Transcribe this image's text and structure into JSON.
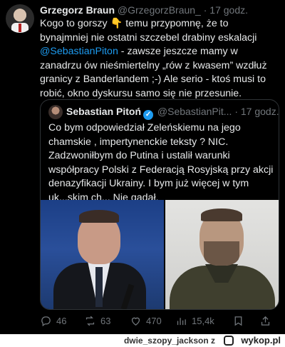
{
  "tweet": {
    "author_name": "Grzegorz Braun",
    "author_handle": "@GrzegorzBraun_",
    "time_sep": "·",
    "time": "17 godz.",
    "text_a": "Kogo to gorszy ",
    "emoji": "👇",
    "text_b": " temu przypomnę, że to bynajmniej nie ostatni szczebel drabiny eskalacji ",
    "mention": "@SebastianPiton",
    "text_c": " - zawsze jeszcze mamy w zanadrzu ów nieśmiertelny „rów z kwasem” wzdłuż granicy z Banderlandem ;-) Ale serio - ktoś musi to robić, okno dyskursu samo się nie przesunie."
  },
  "quote": {
    "author_name": "Sebastian Pitoń",
    "verified": "✓",
    "author_handle": "@SebastianPit...",
    "time_sep": "·",
    "time": "17 godz.",
    "text": "Co bym odpowiedział Zeleńskiemu na jego chamskie , impertynenckie teksty ?    NIC. Zadzwoniłbym do Putina i ustalił warunki współpracy Polski z Federacją Rosyjską przy akcji denazyfikacji Ukrainy. I bym już więcej w tym uk...skim ch...  Nie gadał."
  },
  "actions": {
    "replies": "46",
    "reposts": "63",
    "likes": "470",
    "views": "15,4k"
  },
  "footer": {
    "username": "dwie_szopy_jackson",
    "by": "z",
    "brand": "wykop.pl"
  },
  "colors": {
    "background": "#000000",
    "text": "#e7e9ea",
    "muted": "#71767b",
    "accent": "#1d9bf0"
  },
  "icons": [
    "reply-icon",
    "repost-icon",
    "like-icon",
    "views-icon",
    "bookmark-icon",
    "share-icon",
    "verified-badge-icon",
    "wykop-logo-icon"
  ]
}
